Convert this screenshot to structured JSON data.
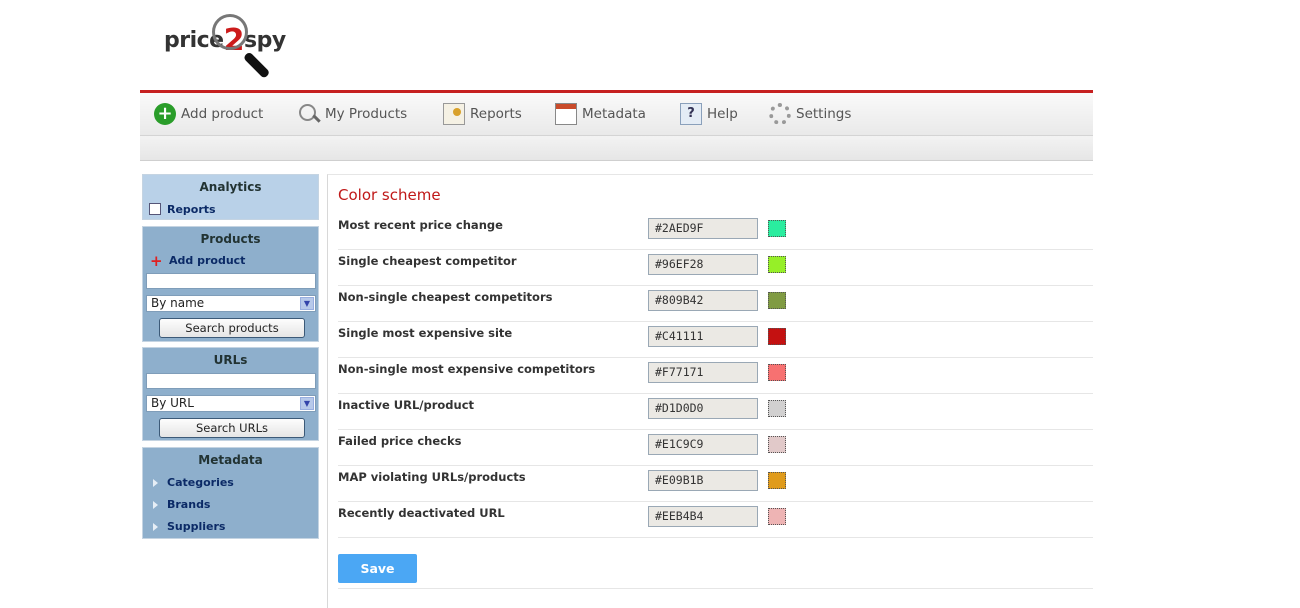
{
  "logo": {
    "pre": "price",
    "mid": "2",
    "post": "spy"
  },
  "nav": [
    {
      "label": "Add product",
      "icon": "add-circle-icon"
    },
    {
      "label": "My Products",
      "icon": "magnifier-icon"
    },
    {
      "label": "Reports",
      "icon": "reports-icon"
    },
    {
      "label": "Metadata",
      "icon": "calendar-table-icon"
    },
    {
      "label": "Help",
      "icon": "help-icon"
    },
    {
      "label": "Settings",
      "icon": "gear-icon"
    }
  ],
  "sidebar": {
    "analytics": {
      "title": "Analytics",
      "links": [
        "Reports"
      ]
    },
    "products": {
      "title": "Products",
      "add_link": "Add product",
      "search_value": "",
      "select_value": "By name",
      "button": "Search products"
    },
    "urls": {
      "title": "URLs",
      "search_value": "",
      "select_value": "By URL",
      "button": "Search URLs"
    },
    "metadata": {
      "title": "Metadata",
      "links": [
        "Categories",
        "Brands",
        "Suppliers"
      ]
    }
  },
  "main": {
    "title": "Color scheme",
    "rows": [
      {
        "label": "Most recent price change",
        "hex": "#2AED9F",
        "color": "#2AED9F"
      },
      {
        "label": "Single cheapest competitor",
        "hex": "#96EF28",
        "color": "#96EF28"
      },
      {
        "label": "Non-single cheapest competitors",
        "hex": "#809B42",
        "color": "#809B42"
      },
      {
        "label": "Single most expensive site",
        "hex": "#C41111",
        "color": "#C41111"
      },
      {
        "label": "Non-single most expensive competitors",
        "hex": "#F77171",
        "color": "#F77171"
      },
      {
        "label": "Inactive URL/product",
        "hex": "#D1D0D0",
        "color": "#D1D0D0"
      },
      {
        "label": "Failed price checks",
        "hex": "#E1C9C9",
        "color": "#E1C9C9"
      },
      {
        "label": "MAP violating URLs/products",
        "hex": "#E09B1B",
        "color": "#E09B1B"
      },
      {
        "label": "Recently deactivated URL",
        "hex": "#EEB4B4",
        "color": "#EEB4B4"
      }
    ],
    "save_label": "Save"
  },
  "colors": {
    "accent_red": "#c62020",
    "save_blue": "#4ba7f4",
    "sidebar_blue": "#8eafcc"
  }
}
